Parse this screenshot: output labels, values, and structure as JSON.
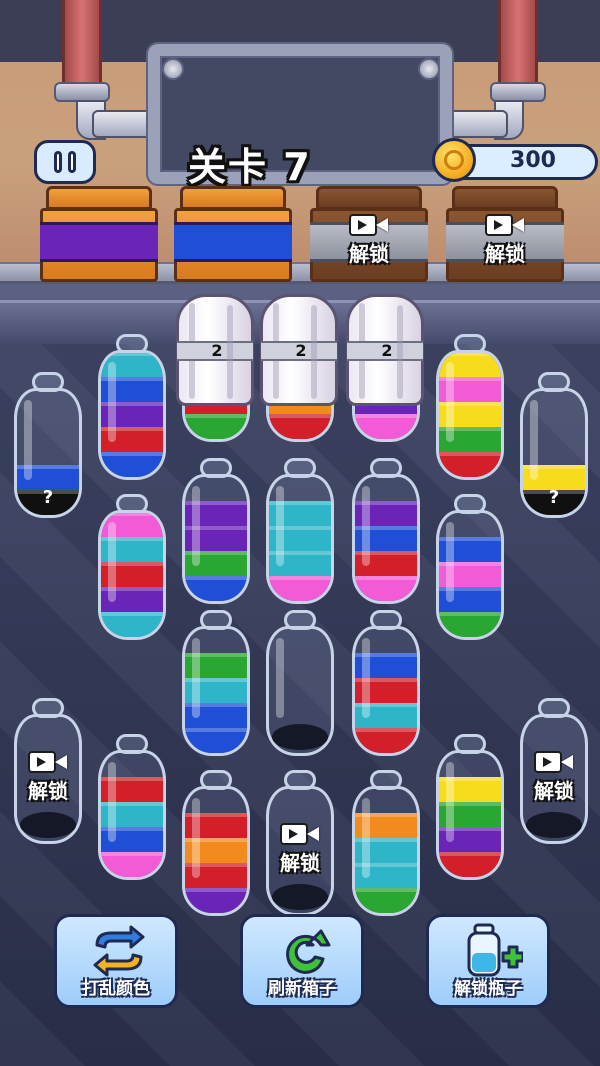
{
  "header": {
    "level_label": "关卡 7",
    "coins": "300"
  },
  "colors": {
    "red": "#d21f2a",
    "blue": "#1f4fd6",
    "purple": "#6a24b8",
    "green": "#2aa632",
    "cyan": "#2fb5c8",
    "pink": "#f25ad6",
    "yellow": "#f6dc1a",
    "orange": "#f38a1e",
    "black": "#101010"
  },
  "crates": [
    {
      "state": "filled",
      "color": "purple"
    },
    {
      "state": "filled",
      "color": "blue"
    },
    {
      "state": "locked",
      "label": "解锁",
      "icon": "video-icon"
    },
    {
      "state": "locked",
      "label": "解锁",
      "icon": "video-icon"
    }
  ],
  "covered_bottles": [
    {
      "count": "2",
      "visible_bottom": [
        "green",
        "red"
      ]
    },
    {
      "count": "2",
      "visible_bottom": [
        "red",
        "orange"
      ]
    },
    {
      "count": "2",
      "visible_bottom": [
        "pink",
        "purple"
      ]
    }
  ],
  "bottles": [
    {
      "id": "b1",
      "layers": [
        "blue",
        "red",
        "purple",
        "blue",
        "cyan"
      ]
    },
    {
      "id": "b2",
      "layers": [
        "black",
        "blue"
      ],
      "hidden_mark": "?"
    },
    {
      "id": "b3",
      "layers": [
        "red",
        "green",
        "yellow",
        "pink",
        "yellow"
      ]
    },
    {
      "id": "b4",
      "layers": [
        "black",
        "yellow"
      ],
      "hidden_mark": "?"
    },
    {
      "id": "b5",
      "layers": [
        "cyan",
        "purple",
        "red",
        "cyan",
        "pink"
      ]
    },
    {
      "id": "b6",
      "layers": [
        "blue",
        "green",
        "purple",
        "purple"
      ]
    },
    {
      "id": "b7",
      "layers": [
        "pink",
        "cyan",
        "cyan",
        "cyan"
      ]
    },
    {
      "id": "b8",
      "layers": [
        "pink",
        "red",
        "blue",
        "purple"
      ]
    },
    {
      "id": "b9",
      "layers": [
        "green",
        "blue",
        "pink",
        "blue"
      ]
    },
    {
      "id": "b10",
      "layers": [
        "blue",
        "blue",
        "cyan",
        "green"
      ]
    },
    {
      "id": "b11",
      "layers": []
    },
    {
      "id": "b12",
      "layers": [
        "red",
        "cyan",
        "red",
        "blue"
      ]
    },
    {
      "id": "b13",
      "layers": [
        "pink",
        "blue",
        "cyan",
        "red"
      ]
    },
    {
      "id": "b14",
      "layers": [
        "purple",
        "red",
        "orange",
        "red"
      ]
    },
    {
      "id": "b15",
      "layers": [
        "green",
        "cyan",
        "cyan",
        "orange"
      ]
    },
    {
      "id": "b16",
      "layers": [
        "red",
        "purple",
        "green",
        "yellow"
      ]
    }
  ],
  "locked_bottles": [
    {
      "label": "解锁",
      "icon": "video-icon"
    },
    {
      "label": "解锁",
      "icon": "video-icon"
    },
    {
      "label": "解锁",
      "icon": "video-icon"
    }
  ],
  "tools": [
    {
      "label": "打乱颜色",
      "icon": "shuffle-icon"
    },
    {
      "label": "刷新箱子",
      "icon": "refresh-icon"
    },
    {
      "label": "解锁瓶子",
      "icon": "bottle-plus-icon"
    }
  ]
}
